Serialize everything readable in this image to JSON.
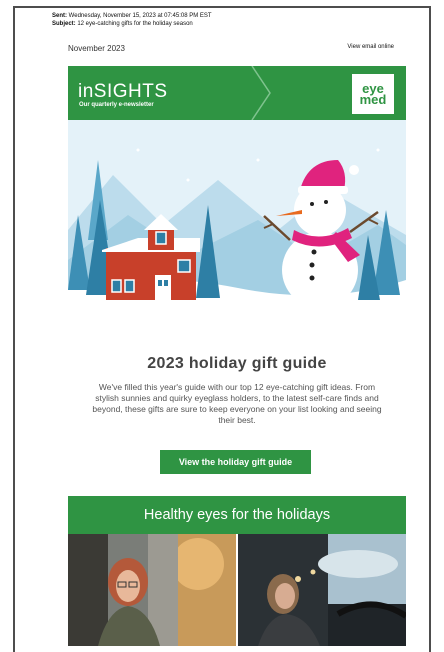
{
  "header": {
    "sent_label": "Sent:",
    "sent_value": "Wednesday, November 15, 2023 at 07:45:08 PM EST",
    "subject_label": "Subject:",
    "subject_value": "12 eye-catching gifts for the holiday season"
  },
  "email": {
    "month": "November 2023",
    "view_online": "View email online",
    "banner_title": "inSIGHTS",
    "banner_subtitle": "Our quarterly e-newsletter",
    "logo_line1": "eye",
    "logo_line2": "med",
    "headline": "2023 holiday gift guide",
    "body": "We've filled this year's guide with our top 12 eye-catching gift ideas. From stylish sunnies and quirky eyeglass holders, to the latest self-care finds and beyond, these gifts are sure to keep everyone on your list looking and seeing their best.",
    "cta_label": "View the holiday gift guide",
    "section_title": "Healthy eyes for the holidays"
  },
  "colors": {
    "brand_green": "#2f9443",
    "sky": "#d9eef7",
    "house_red": "#c8402a",
    "scarf_pink": "#e0237e"
  }
}
